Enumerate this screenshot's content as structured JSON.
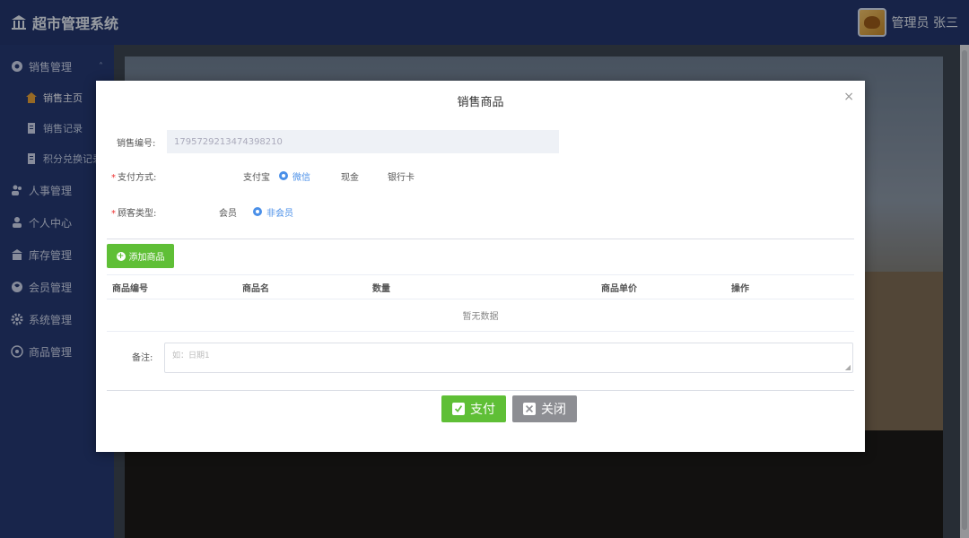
{
  "header": {
    "app_title": "超市管理系统",
    "user_label": "管理员 张三"
  },
  "sidebar": {
    "sales_group": "销售管理",
    "sub_items": [
      "销售主页",
      "销售记录",
      "积分兑换记录"
    ],
    "items": [
      "人事管理",
      "个人中心",
      "库存管理",
      "会员管理",
      "系统管理",
      "商品管理"
    ]
  },
  "modal": {
    "title": "销售商品",
    "close_symbol": "×",
    "sales_no_label": "销售编号:",
    "sales_no_value": "1795729213474398210",
    "pay_label": "支付方式:",
    "pay_options": [
      "支付宝",
      "微信",
      "现金",
      "银行卡"
    ],
    "pay_selected": "微信",
    "customer_label": "顾客类型:",
    "customer_options": [
      "会员",
      "非会员"
    ],
    "customer_selected": "非会员",
    "add_button": "添加商品",
    "table": {
      "headers": [
        "商品编号",
        "商品名",
        "数量",
        "商品单价",
        "操作"
      ],
      "empty_text": "暂无数据"
    },
    "remark_label": "备注:",
    "remark_placeholder": "如：日期1",
    "pay_button": "支付",
    "close_button": "关闭"
  },
  "colors": {
    "header_bg": "#24366f",
    "sidebar_bg": "#263a73",
    "primary_green": "#5fbf36",
    "radio_blue": "#4a8fe8",
    "close_gray": "#8d8e93"
  }
}
